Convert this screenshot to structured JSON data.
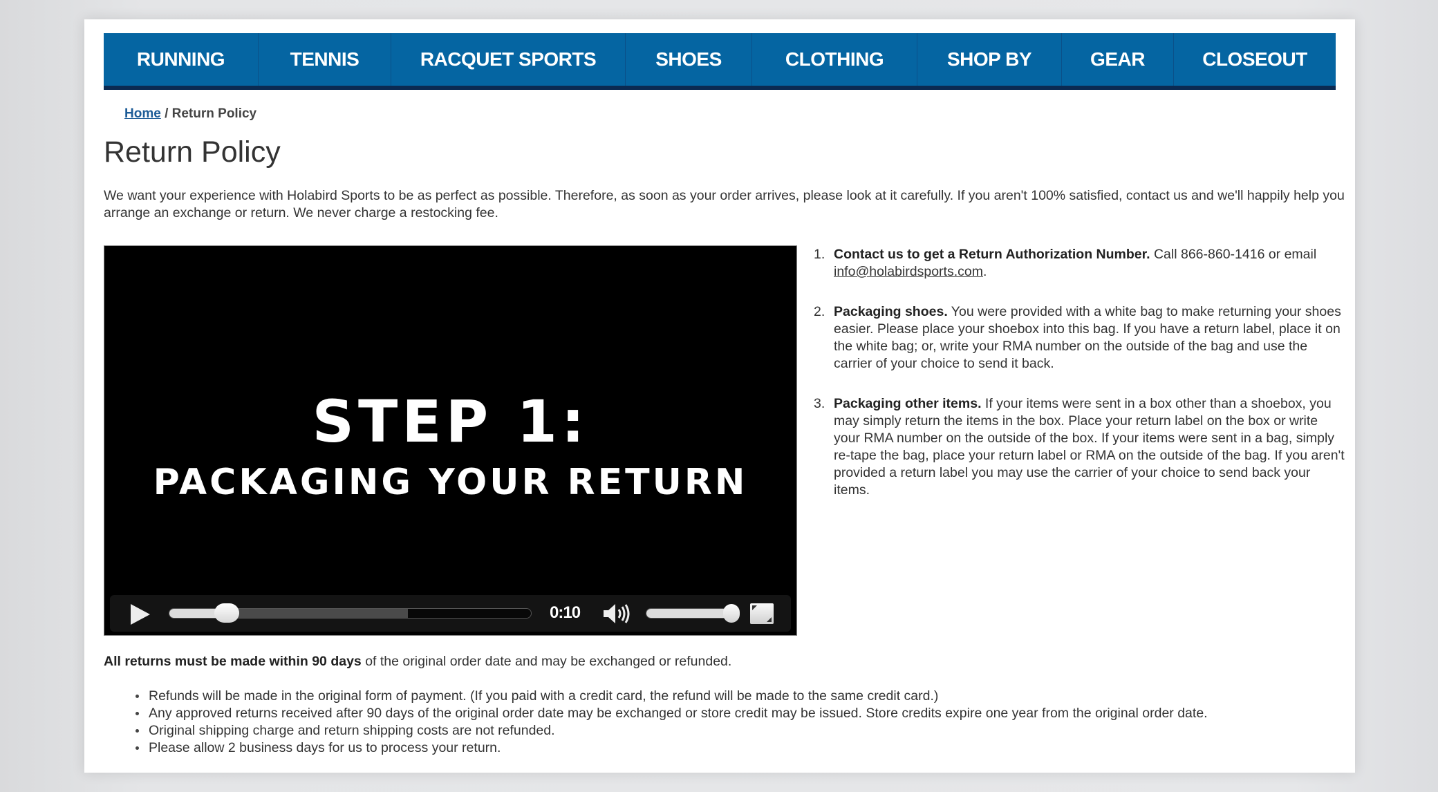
{
  "nav": {
    "items": [
      {
        "label": "RUNNING"
      },
      {
        "label": "TENNIS"
      },
      {
        "label": "RACQUET SPORTS"
      },
      {
        "label": "SHOES"
      },
      {
        "label": "CLOTHING"
      },
      {
        "label": "SHOP BY"
      },
      {
        "label": "GEAR"
      },
      {
        "label": "CLOSEOUT"
      }
    ],
    "color": "#0565a2",
    "border_color": "#0b2a52"
  },
  "breadcrumb": {
    "home": "Home",
    "separator": " / ",
    "current": "Return Policy"
  },
  "page_title": "Return Policy",
  "intro": "We want your experience with Holabird Sports to be as perfect as possible. Therefore, as soon as your order arrives, please look at it carefully. If you aren't 100% satisfied, contact us and we'll happily help you arrange an exchange or return. We never charge a restocking fee.",
  "video": {
    "title_line1": "STEP 1:",
    "title_line2": "PACKAGING YOUR RETURN",
    "time": "0:10",
    "progress_percent": 16,
    "buffered_percent": 66,
    "volume_percent": 95,
    "icons": {
      "play": "play-icon",
      "volume": "volume-icon",
      "fullscreen": "fullscreen-icon"
    }
  },
  "steps": [
    {
      "num": "1.",
      "title": "Contact us to get a Return Authorization Number.",
      "text": " Call 866-860-1416 or email ",
      "link": "info@holabirdsports.com",
      "after": "."
    },
    {
      "num": "2.",
      "title": "Packaging shoes.",
      "text": " You were provided with a white bag to make returning your shoes easier. Please place your shoebox into this bag. If you have a return label, place it on the white bag; or, write your RMA number on the outside of the bag and use the carrier of your choice to send it back."
    },
    {
      "num": "3.",
      "title": "Packaging other items.",
      "text": " If your items were sent in a box other than a shoebox, you may simply return the items in the box. Place your return label on the box or write your RMA number on the outside of the box. If your items were sent in a bag, simply re-tape the bag, place your return label or RMA on the outside of the bag. If you aren't provided a return label you may use the carrier of your choice to send back your items."
    }
  ],
  "notice": {
    "bold": "All returns must be made within 90 days",
    "text": " of the original order date and may be exchanged or refunded."
  },
  "bullets": [
    "Refunds will be made in the original form of payment. (If you paid with a credit card, the refund will be made to the same credit card.)",
    "Any approved returns received after 90 days of the original order date may be exchanged or store credit may be issued. Store credits expire one year from the original order date.",
    "Original shipping charge and return shipping costs are not refunded.",
    "Please allow 2 business days for us to process your return."
  ]
}
